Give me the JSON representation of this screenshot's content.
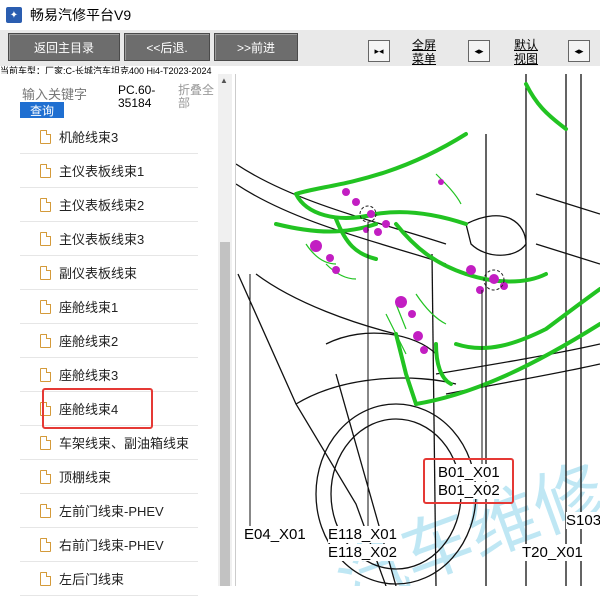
{
  "window": {
    "title": "畅易汽修平台V9"
  },
  "toolbar": {
    "back_main": "返回主目录",
    "prev": "<<后退.",
    "next": ">>前进",
    "fullscreen_label": "全屏\n菜单",
    "default_view_label": "默认\n视图"
  },
  "vehicle": {
    "model_line": "当前车型：厂家:C-长城汽车坦克400 Hi4-T2023-2024"
  },
  "search": {
    "label": "输入关键字",
    "button": "查询",
    "code": "PC.60-\n35184",
    "collapse": "折叠全\n部"
  },
  "sidebar": {
    "items": [
      {
        "label": "机舱线束3"
      },
      {
        "label": "主仪表板线束1"
      },
      {
        "label": "主仪表板线束2"
      },
      {
        "label": "主仪表板线束3"
      },
      {
        "label": "副仪表板线束"
      },
      {
        "label": "座舱线束1"
      },
      {
        "label": "座舱线束2"
      },
      {
        "label": "座舱线束3"
      },
      {
        "label": "座舱线束4"
      },
      {
        "label": "车架线束、副油箱线束"
      },
      {
        "label": "顶棚线束"
      },
      {
        "label": "左前门线束-PHEV"
      },
      {
        "label": "右前门线束-PHEV"
      },
      {
        "label": "左后门线束"
      }
    ]
  },
  "diagram": {
    "labels": {
      "b01_x01": "B01_X01",
      "b01_x02": "B01_X02",
      "e04_x01": "E04_X01",
      "e118_x01": "E118_X01",
      "e118_x02": "E118_X02",
      "s103": "S103",
      "t20_x01": "T20_X01"
    },
    "watermark": "汽车维修"
  },
  "colors": {
    "harness": "#22c322",
    "connector": "#c21ec2",
    "highlight": "#e53935"
  }
}
